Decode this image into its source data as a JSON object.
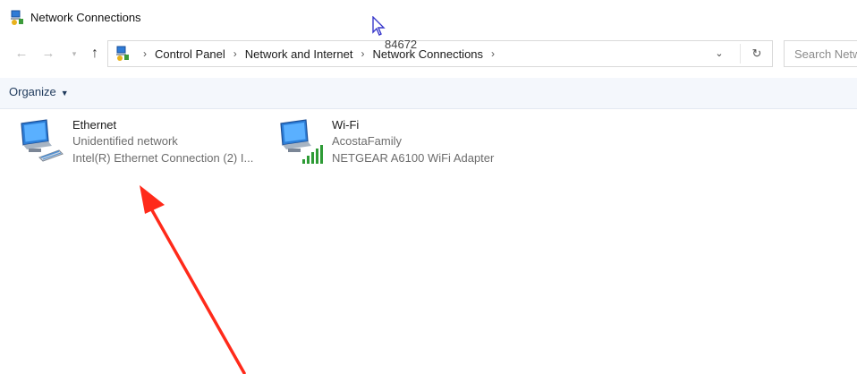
{
  "window": {
    "title": "Network Connections"
  },
  "nav": {
    "back_icon": "back-arrow-icon",
    "forward_icon": "forward-arrow-icon",
    "recent_icon": "chevron-down-icon",
    "up_icon": "up-arrow-icon"
  },
  "address_bar": {
    "crumbs": [
      "Control Panel",
      "Network and Internet",
      "Network Connections"
    ],
    "overlay_number": "84672",
    "dropdown_icon": "chevron-down-icon",
    "refresh_icon": "refresh-icon"
  },
  "search": {
    "placeholder": "Search Netw"
  },
  "command_bar": {
    "organize_label": "Organize"
  },
  "connections": [
    {
      "name": "Ethernet",
      "status": "Unidentified network",
      "device": "Intel(R) Ethernet Connection (2) I...",
      "icon": "ethernet-adapter-icon"
    },
    {
      "name": "Wi-Fi",
      "status": "AcostaFamily",
      "device": "NETGEAR A6100 WiFi Adapter",
      "icon": "wifi-adapter-icon"
    }
  ],
  "annotation": {
    "arrow_color": "#ff2a1a"
  }
}
